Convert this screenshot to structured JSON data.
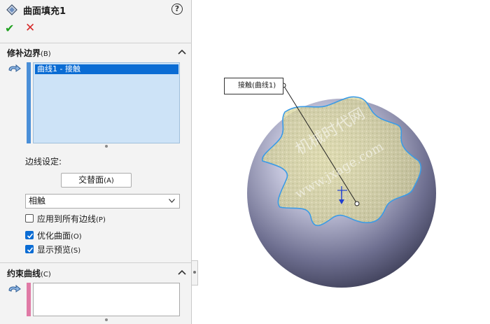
{
  "header": {
    "title": "曲面填充1",
    "help_glyph": "?"
  },
  "actions": {
    "ok_glyph": "✔",
    "cancel_glyph": "✕"
  },
  "patch_boundary": {
    "title": "修补边界",
    "hotkey": "(B)",
    "items": [
      "曲线1 - 接触"
    ],
    "edge_settings_label": "边线设定:",
    "alternate_face_button": "交替面",
    "alternate_face_hotkey": "(A)",
    "contact_type_value": "相触",
    "apply_all_edges": {
      "label": "应用到所有边线",
      "hotkey": "(P)",
      "checked": false
    },
    "optimize_surface": {
      "label": "优化曲面",
      "hotkey": "(O)",
      "checked": true
    },
    "show_preview": {
      "label": "显示预览",
      "hotkey": "(S)",
      "checked": true
    }
  },
  "constraint_curves": {
    "title": "约束曲线",
    "hotkey": "(C)",
    "items": []
  },
  "viewport": {
    "callout_label": "接触(曲线1)",
    "watermark_cn": "机械时代网",
    "watermark_url": "www.jxage.com"
  },
  "colors": {
    "selection_list_bg": "#cde3f7",
    "selection_highlight": "#0a6cd4",
    "boundary_strip": "#4a8fd8",
    "constraint_strip": "#e07aa6",
    "ok_green": "#21a121",
    "cancel_red": "#d62b2b",
    "boundary_curve": "#3a9be6",
    "fill_preview": "#d9d080"
  },
  "icons": {
    "feature": "surface-fill-icon",
    "help": "help-icon",
    "ok": "checkmark-icon",
    "cancel": "close-icon",
    "collapse": "chevron-up-icon",
    "selection": "edge-selection-icon",
    "dropdown": "chevron-down-icon"
  }
}
